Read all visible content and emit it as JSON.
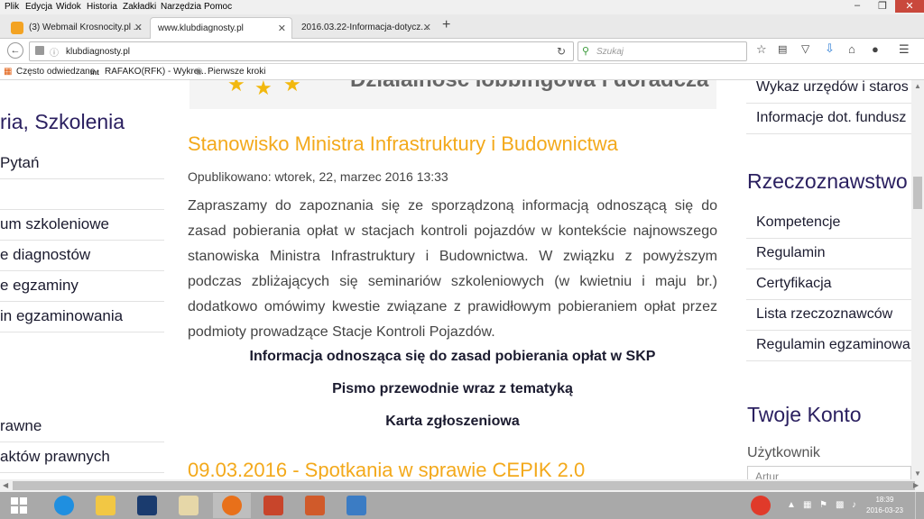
{
  "menubar": {
    "items": [
      "Plik",
      "Edycja",
      "Widok",
      "Historia",
      "Zakładki",
      "Narzędzia",
      "Pomoc"
    ]
  },
  "tabs": [
    {
      "label": "(3) Webmail Krosnocity.pl ...",
      "active": false
    },
    {
      "label": "www.klubdiagnosty.pl",
      "active": true
    },
    {
      "label": "2016.03.22-Informacja-dotycz...",
      "active": false
    }
  ],
  "navbar": {
    "url": "klubdiagnosty.pl",
    "search_placeholder": "Szukaj"
  },
  "bookmarks": [
    "Często odwiedzane",
    "RAFAKO(RFK) - Wykre...",
    "Pierwsze kroki"
  ],
  "left_sidebar": {
    "heading": "ria, Szkolenia",
    "items": [
      "Pytań",
      "",
      "um szkoleniowe",
      "e diagnostów",
      "e egzaminy",
      "in egzaminowania",
      "",
      "",
      "rawne",
      "aktów prawnych"
    ]
  },
  "banner": {
    "text": "Działalność lobbingowa i doradcza"
  },
  "article": {
    "title": "Stanowisko Ministra Infrastruktury i Budownictwa",
    "published": "Opublikowano: wtorek, 22, marzec 2016 13:33",
    "body": "Zapraszamy do zapoznania się ze sporządzoną informacją odnoszącą się do zasad pobierania opłat w stacjach kontroli pojazdów w kontekście najnowszego stanowiska Ministra Infrastruktury i Budownictwa. W związku z powyższym podczas zbliżających się seminariów szkoleniowych (w kwietniu i maju br.) dodatkowo omówimy kwestie związane z prawidłowym pobieraniem opłat przez podmioty prowadzące Stacje Kontroli Pojazdów.",
    "links": [
      "Informacja odnosząca się do zasad pobierania opłat w SKP",
      "Pismo przewodnie wraz z tematyką",
      "Karta zgłoszeniowa"
    ]
  },
  "article2": {
    "title": "09.03.2016 - Spotkania w sprawie CEPIK 2.0"
  },
  "right_sidebar": {
    "top_items": [
      "Wykaz urzędów i staros",
      "Informacje dot. fundusz"
    ],
    "heading1": "Rzeczoznawstwo",
    "items": [
      "Kompetencje",
      "Regulamin",
      "Certyfikacja",
      "Lista rzeczoznawców",
      "Regulamin egzaminowa"
    ],
    "heading2": "Twoje Konto",
    "user_label": "Użytkownik",
    "user_value": "Artur"
  },
  "taskbar": {
    "time": "18:39",
    "date": "2016-03-23"
  }
}
